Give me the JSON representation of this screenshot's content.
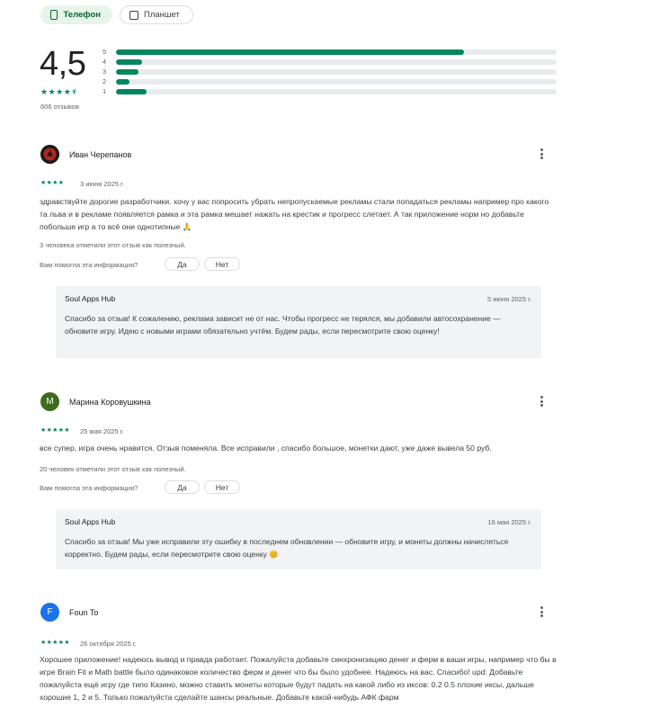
{
  "device_chips": [
    {
      "label": "Телефон",
      "selected": true
    },
    {
      "label": "Планшет",
      "selected": false
    }
  ],
  "summary": {
    "score": "4,5",
    "stars": "★★★★⯨",
    "count": "606 отзывов",
    "histogram": [
      {
        "label": "5",
        "fraction": 0.79
      },
      {
        "label": "4",
        "fraction": 0.06
      },
      {
        "label": "3",
        "fraction": 0.05
      },
      {
        "label": "2",
        "fraction": 0.03
      },
      {
        "label": "1",
        "fraction": 0.07
      }
    ]
  },
  "colors": {
    "accent": "#01875f",
    "selected_chip_bg": "#e6f4ea",
    "reply_bg": "#f1f3f4"
  },
  "reviews": [
    {
      "author": "Иван Черепанов",
      "avatar_color": "#b3261e",
      "avatar_letter": "",
      "stars": "★★★★",
      "date": "3 июня 2025 г.",
      "text": "здравствуйте дорогие разработчики. хочу у вас попросить убрать непропускаемые рекламы стали попадаться рекламы например про какого та льва и в рекламе появляется рамка и эта рамка мешает нажать на крестик и прогресс слетает. А так приложение норм но добавьте побольше игр а то всё они однотипные 🙏",
      "helpful": "3 человека отметили этот отзыв как полезный.",
      "question": "Вам помогла эта информация?",
      "yes": "Да",
      "no": "Нет",
      "reply": {
        "developer": "Soul Apps Hub",
        "date": "5 июня 2025 г.",
        "text": "Спасибо за отзыв! К сожалению, реклама зависит не от нас. Чтобы прогресс не терялся, мы добавили автосохранение — обновите игру. Идею с новыми играми обязательно учтём. Будем рады, если пересмотрите свою оценку!"
      }
    },
    {
      "author": "Марина Коровушкина",
      "avatar_color": "#3e6b1f",
      "avatar_letter": "М",
      "stars": "★★★★★",
      "date": "25 мая 2025 г.",
      "text": "все супер, игра очень нравится. Отзыв поменяла. Все исправили , спасибо большое, монетки дают, уже даже вывела 50 руб.",
      "helpful": "20 человек отметили этот отзыв как полезный.",
      "question": "Вам помогла эта информация?",
      "yes": "Да",
      "no": "Нет",
      "reply": {
        "developer": "Soul Apps Hub",
        "date": "16 мая 2025 г.",
        "text": "Спасибо за отзыв! Мы уже исправили эту ошибку в последнем обновлении — обновите игру, и монеты должны начисляться корректно. Будем рады, если пересмотрите свою оценку 😊"
      }
    },
    {
      "author": "Foun To",
      "avatar_color": "#1a73e8",
      "avatar_letter": "F",
      "stars": "★★★★★",
      "date": "26 октября 2025 г.",
      "text": "Хорошее приложение! надеюсь вывод и правда работает. Пожалуйста добавьте синхронизацию денег и ферм в ваши игры, например что бы в игре Brain Fit и Math battle было одинаковое количество ферм и денег что бы было удобнее. Надеюсь на вас. Спасибо! upd: Добавьте пожалуйста ещё игру где типо Казино, можно ставить монеты которые будут падать на какой либо из иксов: 0.2 0.5 плохие иксы, дальше хорошие 1, 2 и 5. Только пожалуйста сделайте шансы реальные. Добавьте какой-нибудь АФК фарм"
    }
  ]
}
